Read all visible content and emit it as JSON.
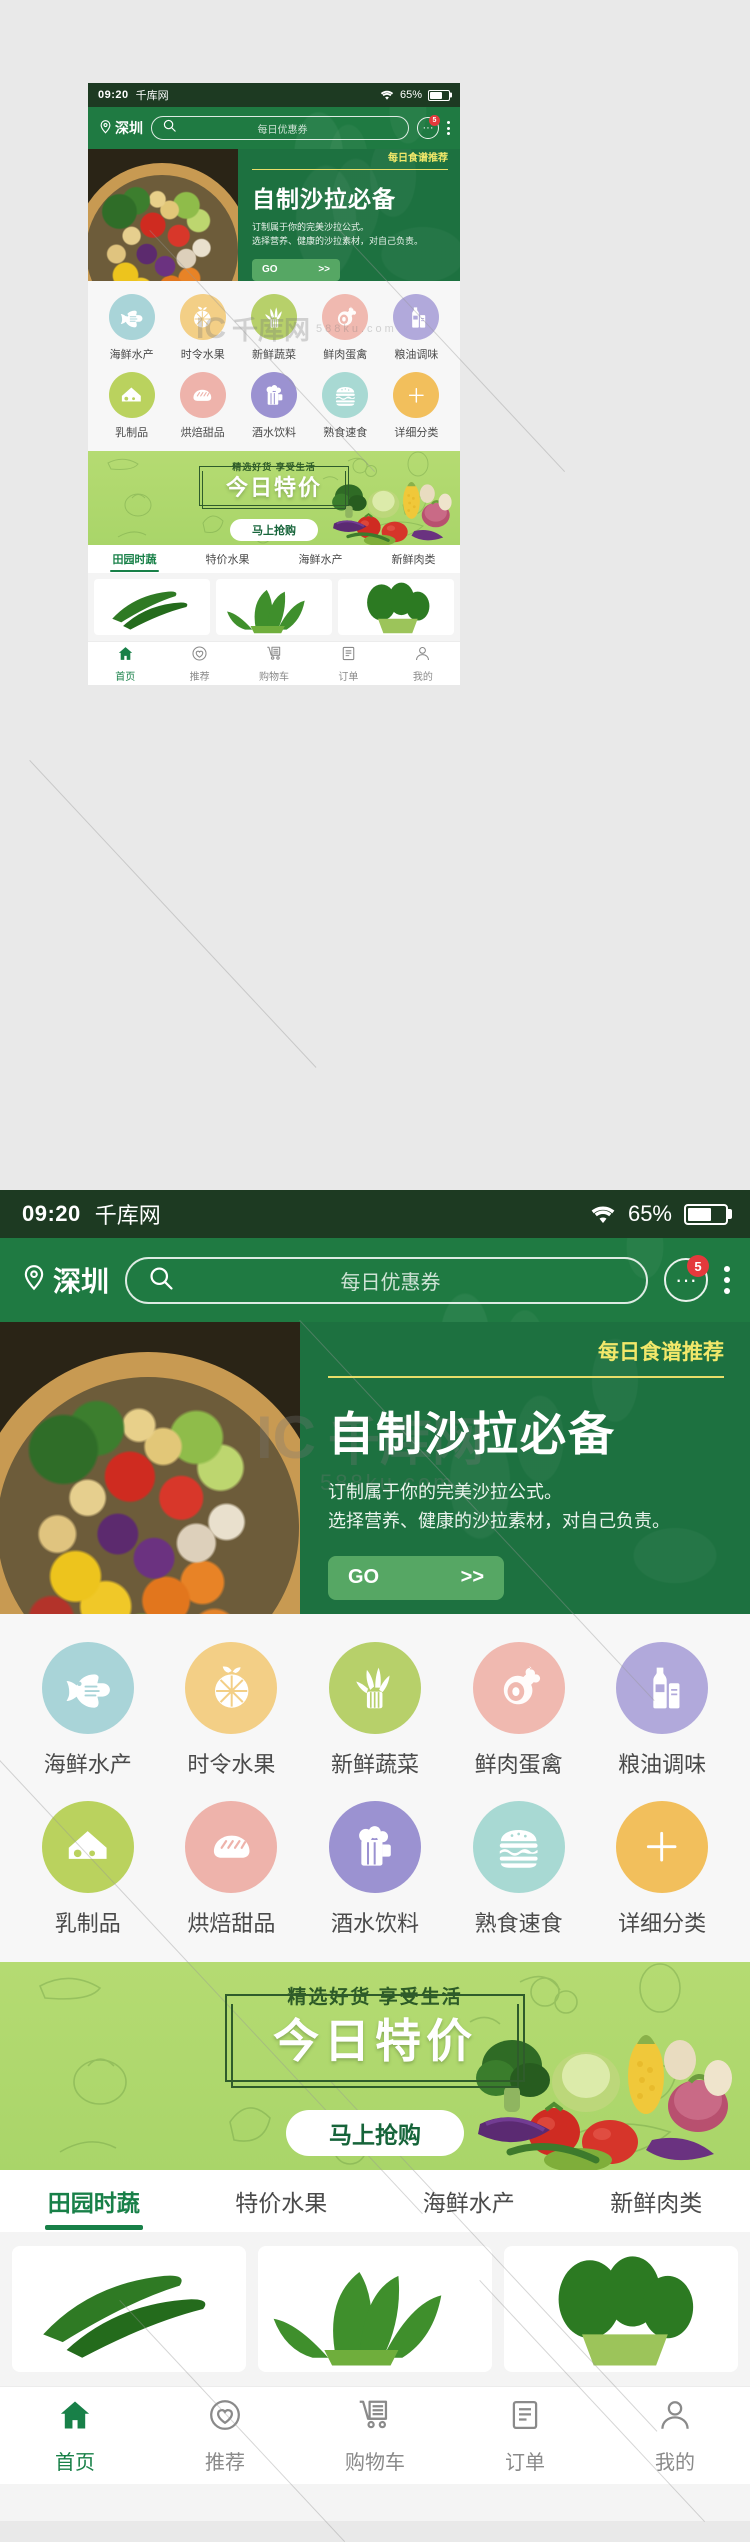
{
  "status_bar": {
    "time": "09:20",
    "brand": "千库网",
    "battery_percent": "65%",
    "wifi_icon": "wifi-icon",
    "battery_icon": "battery-icon"
  },
  "header": {
    "location": "深圳",
    "location_icon": "map-pin-icon",
    "search_icon": "search-icon",
    "search_placeholder": "每日优惠券",
    "message_icon": "ellipsis-circle-icon",
    "message_badge": "5",
    "more_icon": "more-vertical-icon"
  },
  "hero": {
    "kicker": "每日食谱推荐",
    "title": "自制沙拉必备",
    "subtitle_line1": "订制属于你的完美沙拉公式。",
    "subtitle_line2": "选择营养、健康的沙拉素材，对自己负责。",
    "cta_label": "GO",
    "cta_arrow": ">>",
    "image_alt": "salad-bowl-photo"
  },
  "categories": {
    "row1": [
      {
        "label": "海鲜水产",
        "icon": "fish-icon",
        "color": "#a9d4d8"
      },
      {
        "label": "时令水果",
        "icon": "orange-icon",
        "color": "#f3cf86"
      },
      {
        "label": "新鲜蔬菜",
        "icon": "vegetable-icon",
        "color": "#b7d06a"
      },
      {
        "label": "鲜肉蛋禽",
        "icon": "ham-icon",
        "color": "#f0b9b0"
      },
      {
        "label": "粮油调味",
        "icon": "bottle-icon",
        "color": "#b1a9db"
      }
    ],
    "row2": [
      {
        "label": "乳制品",
        "icon": "cheese-icon",
        "color": "#bad25e"
      },
      {
        "label": "烘焙甜品",
        "icon": "bread-icon",
        "color": "#eeb3ab"
      },
      {
        "label": "酒水饮料",
        "icon": "beer-icon",
        "color": "#9b92d1"
      },
      {
        "label": "熟食速食",
        "icon": "burger-icon",
        "color": "#a8d9d3"
      },
      {
        "label": "详细分类",
        "icon": "plus-icon",
        "color": "#f2bf5c"
      }
    ]
  },
  "promo": {
    "kicker": "精选好货 享受生活",
    "title": "今日特价",
    "cta_label": "马上抢购",
    "background_color": "#aed76c",
    "accent_color": "#2f5c2b",
    "image_alt": "assorted-vegetables-photo"
  },
  "tabs": [
    {
      "label": "田园时蔬",
      "active": true
    },
    {
      "label": "特价水果",
      "active": false
    },
    {
      "label": "海鲜水产",
      "active": false
    },
    {
      "label": "新鲜肉类",
      "active": false
    }
  ],
  "products": [
    {
      "name": "cucumber-card",
      "image_alt": "cucumbers-photo"
    },
    {
      "name": "lettuce-card",
      "image_alt": "leafy-greens-photo"
    },
    {
      "name": "bokchoy-card",
      "image_alt": "bok-choy-photo"
    }
  ],
  "bottom_nav": [
    {
      "label": "首页",
      "icon": "home-icon",
      "active": true
    },
    {
      "label": "推荐",
      "icon": "heart-icon",
      "active": false
    },
    {
      "label": "购物车",
      "icon": "cart-icon",
      "active": false
    },
    {
      "label": "订单",
      "icon": "clipboard-icon",
      "active": false
    },
    {
      "label": "我的",
      "icon": "user-icon",
      "active": false
    }
  ],
  "watermark": {
    "brand": "千库网",
    "domain": "588ku.com"
  },
  "theme": {
    "status_bar_bg": "#1d3a22",
    "header_bg": "#1f7a42",
    "hero_bg": "#1d7140",
    "accent_green": "#188048",
    "go_button": "#56a764",
    "badge_red": "#e4393c",
    "page_bg": "#e9e9e9"
  }
}
